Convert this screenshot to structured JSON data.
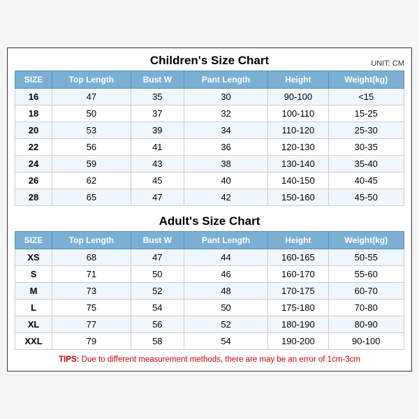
{
  "children_title": "Children's Size Chart",
  "adult_title": "Adult's Size Chart",
  "unit_label": "UNIT: CM",
  "children_headers": [
    "SIZE",
    "Top Length",
    "Bust W",
    "Pant Length",
    "Height",
    "Weight(kg)"
  ],
  "children_rows": [
    [
      "16",
      "47",
      "35",
      "30",
      "90-100",
      "<15"
    ],
    [
      "18",
      "50",
      "37",
      "32",
      "100-110",
      "15-25"
    ],
    [
      "20",
      "53",
      "39",
      "34",
      "110-120",
      "25-30"
    ],
    [
      "22",
      "56",
      "41",
      "36",
      "120-130",
      "30-35"
    ],
    [
      "24",
      "59",
      "43",
      "38",
      "130-140",
      "35-40"
    ],
    [
      "26",
      "62",
      "45",
      "40",
      "140-150",
      "40-45"
    ],
    [
      "28",
      "65",
      "47",
      "42",
      "150-160",
      "45-50"
    ]
  ],
  "adult_headers": [
    "SIZE",
    "Top Length",
    "Bust W",
    "Pant Length",
    "Height",
    "Weight(kg)"
  ],
  "adult_rows": [
    [
      "XS",
      "68",
      "47",
      "44",
      "160-165",
      "50-55"
    ],
    [
      "S",
      "71",
      "50",
      "46",
      "160-170",
      "55-60"
    ],
    [
      "M",
      "73",
      "52",
      "48",
      "170-175",
      "60-70"
    ],
    [
      "L",
      "75",
      "54",
      "50",
      "175-180",
      "70-80"
    ],
    [
      "XL",
      "77",
      "56",
      "52",
      "180-190",
      "80-90"
    ],
    [
      "XXL",
      "79",
      "58",
      "54",
      "190-200",
      "90-100"
    ]
  ],
  "tips_label": "TIPS:",
  "tips_text": " Due to different measurement methods, there are may be an error of 1cm-3cm"
}
